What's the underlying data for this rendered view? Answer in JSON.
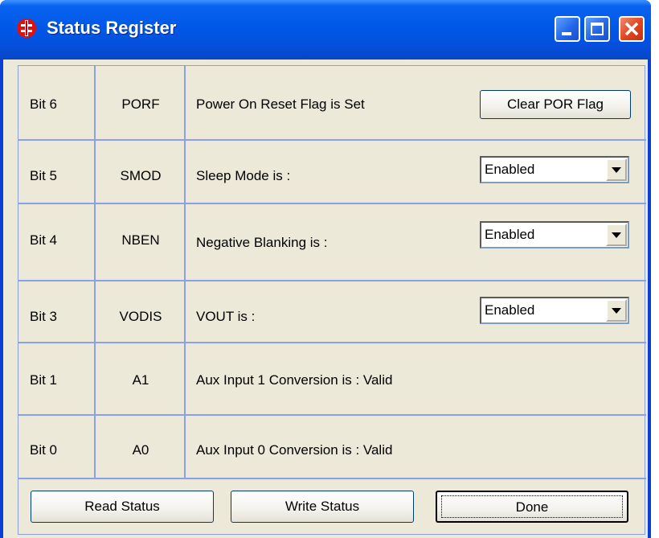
{
  "window": {
    "title": "Status Register",
    "controls": {
      "minimize": "minimize-icon",
      "maximize": "maximize-icon",
      "close": "close-icon"
    },
    "colors": {
      "titlebar": "#0058e6",
      "client": "#ece9d8",
      "grid_lines": "#8aa0e8"
    }
  },
  "rows": [
    {
      "bit": "Bit 6",
      "mnemonic": "PORF",
      "description": "Power On Reset Flag is Set",
      "button": "Clear POR Flag"
    },
    {
      "bit": "Bit 5",
      "mnemonic": "SMOD",
      "description": "Sleep Mode is :",
      "select_value": "Enabled"
    },
    {
      "bit": "Bit 4",
      "mnemonic": "NBEN",
      "description": "Negative Blanking is :",
      "select_value": "Enabled"
    },
    {
      "bit": "Bit 3",
      "mnemonic": "VODIS",
      "description": "VOUT is :",
      "select_value": "Enabled"
    },
    {
      "bit": "Bit 1",
      "mnemonic": "A1",
      "description": "Aux Input 1 Conversion is : Valid"
    },
    {
      "bit": "Bit 0",
      "mnemonic": "A0",
      "description": "Aux Input 0 Conversion is : Valid"
    }
  ],
  "footer": {
    "read_label": "Read Status",
    "write_label": "Write Status",
    "done_label": "Done"
  }
}
